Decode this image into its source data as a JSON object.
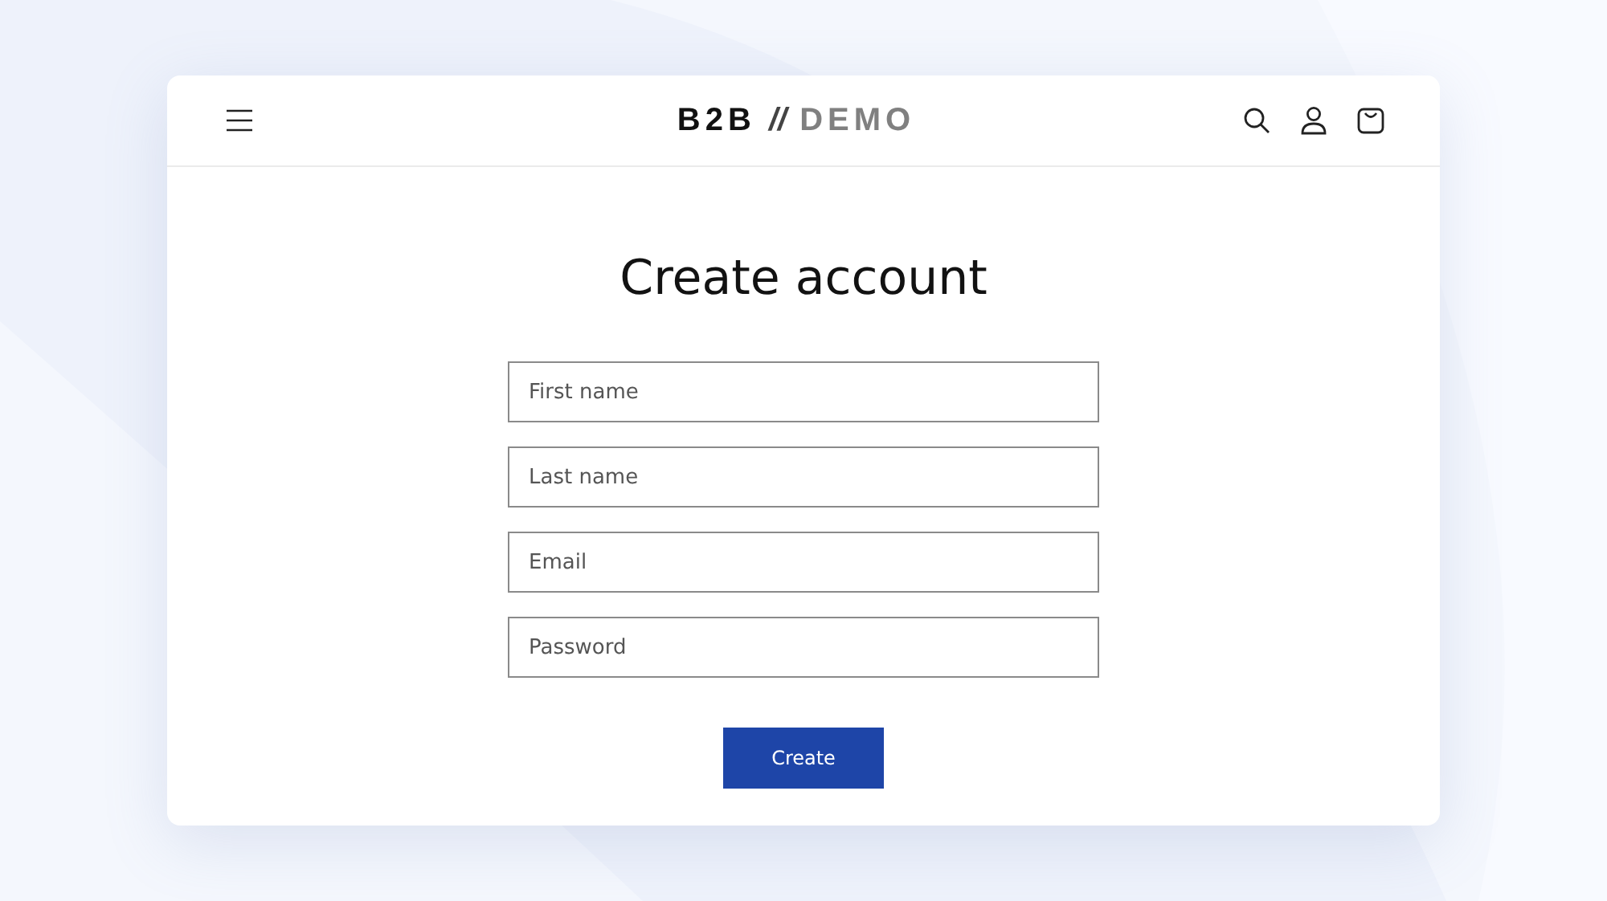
{
  "header": {
    "logo": {
      "primary": "B2B",
      "separator": "//",
      "secondary": "DEMO"
    }
  },
  "form": {
    "title": "Create account",
    "fields": [
      {
        "placeholder": "First name"
      },
      {
        "placeholder": "Last name"
      },
      {
        "placeholder": "Email"
      },
      {
        "placeholder": "Password"
      }
    ],
    "submit": "Create"
  }
}
